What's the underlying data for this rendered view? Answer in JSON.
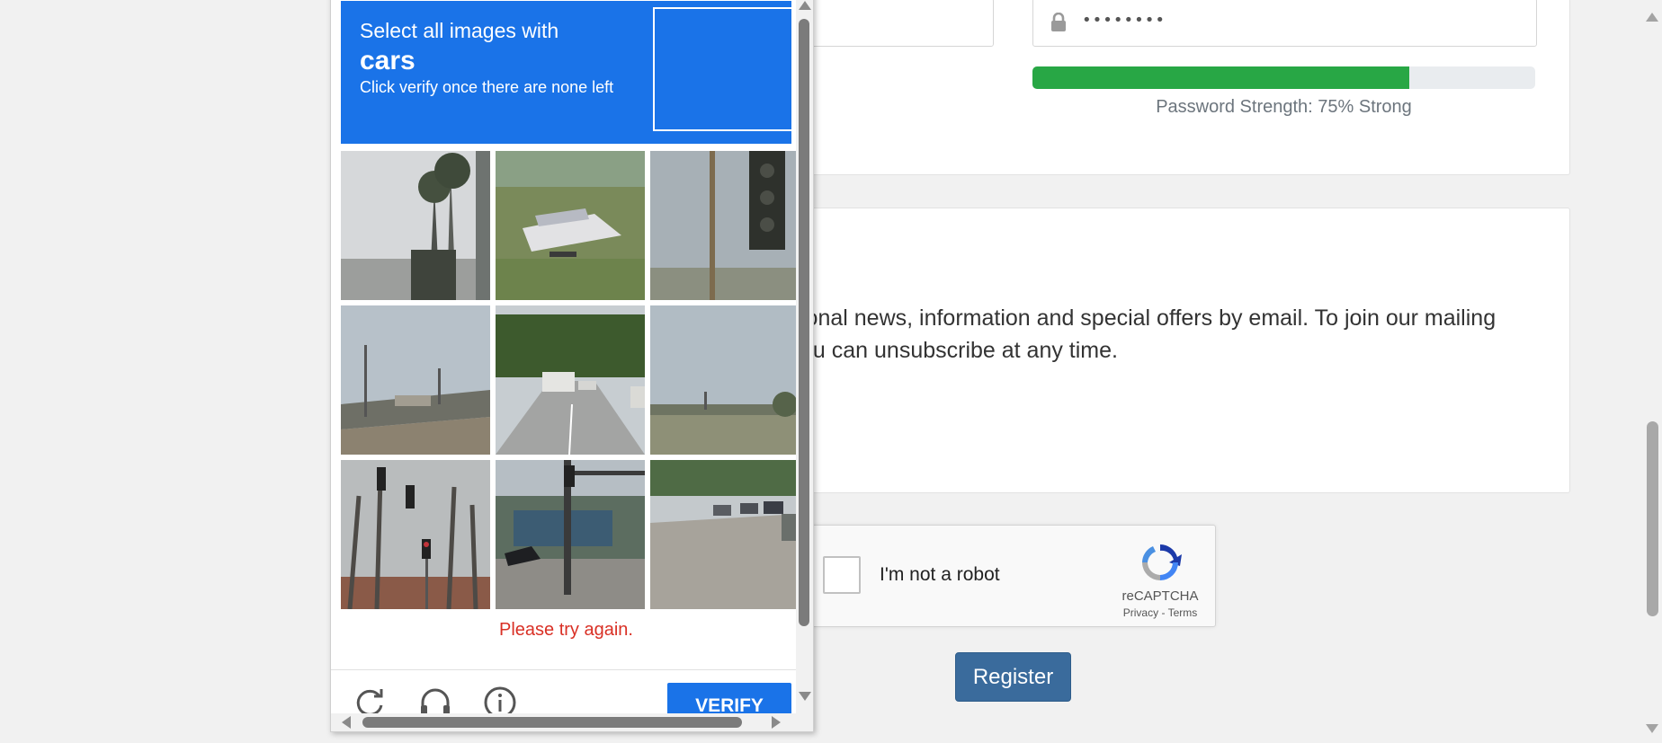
{
  "background": {
    "password_field": {
      "masked_value": "••••••••",
      "icon": "lock-icon"
    },
    "password_strength": {
      "value_percent": 75,
      "label": "Password Strength: 75% Strong",
      "color": "#28a745"
    },
    "newsletter_text": {
      "line1": "ional news, information and special offers by email. To join our mailing",
      "line2": "ou can unsubscribe at any time."
    },
    "recaptcha": {
      "label": "I'm not a robot",
      "brand": "reCAPTCHA",
      "privacy": "Privacy",
      "separator": " - ",
      "terms": "Terms"
    },
    "register_button": {
      "label": "Register",
      "color": "#3a6b9c"
    }
  },
  "challenge": {
    "instruction": "Select all images with",
    "object": "cars",
    "hint": "Click verify once there are none left",
    "header_color": "#1a73e8",
    "tiles": [
      {
        "content": "palm trees against sky"
      },
      {
        "content": "boat on trailer on grass"
      },
      {
        "content": "traffic light pole"
      },
      {
        "content": "highway overpass"
      },
      {
        "content": "road with trucks"
      },
      {
        "content": "grassy roadside"
      },
      {
        "content": "traffic lights and trees"
      },
      {
        "content": "traffic light over street with car"
      },
      {
        "content": "street with parked cars"
      }
    ],
    "error_message": "Please try again.",
    "error_color": "#d93025",
    "controls": {
      "reload_icon": "reload-icon",
      "audio_icon": "headphones-icon",
      "info_icon": "info-icon"
    },
    "verify_label": "VERIFY"
  }
}
